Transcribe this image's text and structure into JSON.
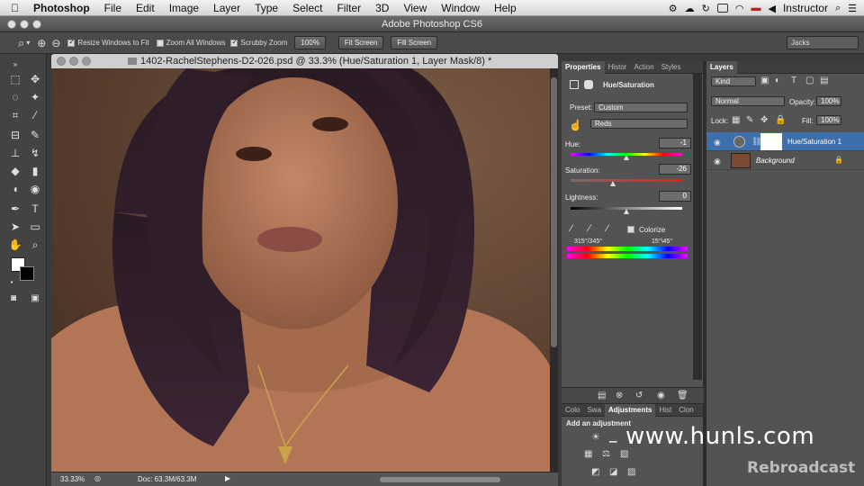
{
  "menubar": {
    "app": "Photoshop",
    "items": [
      "File",
      "Edit",
      "Image",
      "Layer",
      "Type",
      "Select",
      "Filter",
      "3D",
      "View",
      "Window",
      "Help"
    ],
    "user": "Instructor"
  },
  "window": {
    "title": "Adobe Photoshop CS6"
  },
  "options": {
    "resize_label": "Resize Windows to Fit",
    "zoom_all_label": "Zoom All Windows",
    "scrubby_label": "Scrubby Zoom",
    "zoom_btn": "100%",
    "fit_btn": "Fit Screen",
    "fill_btn": "Fill Screen",
    "workspace": "Jacks"
  },
  "document": {
    "tab_title": "1402-RachelStephens-D2-026.psd @ 33.3% (Hue/Saturation 1, Layer Mask/8) *",
    "zoom": "33.33%",
    "doc_size": "Doc: 63.3M/63.3M"
  },
  "properties": {
    "tabs": [
      "Properties",
      "Histor",
      "Action",
      "Styles"
    ],
    "title": "Hue/Saturation",
    "preset_label": "Preset:",
    "preset": "Custom",
    "channel": "Reds",
    "hue_label": "Hue:",
    "hue": "-1",
    "sat_label": "Saturation:",
    "sat": "-26",
    "light_label": "Lightness:",
    "light": "0",
    "colorize_label": "Colorize",
    "range_left": "315°/345°",
    "range_right": "15°\\45°"
  },
  "adjustments": {
    "tabs": [
      "Colo",
      "Swa",
      "Adjustments",
      "Hist",
      "Clon"
    ],
    "add_label": "Add an adjustment"
  },
  "layers": {
    "tab": "Layers",
    "filter": "Kind",
    "blend": "Normal",
    "opacity_label": "Opacity:",
    "opacity": "100%",
    "lock_label": "Lock:",
    "fill_label": "Fill:",
    "fill": "100%",
    "rows": [
      {
        "name": "Hue/Saturation 1"
      },
      {
        "name": "Background"
      }
    ]
  },
  "watermark": "www.hunls.com",
  "brand": "Rebroadcast",
  "colors": {
    "accent": "#3d6faa",
    "panel": "#535353",
    "dark": "#3a3a3a"
  }
}
